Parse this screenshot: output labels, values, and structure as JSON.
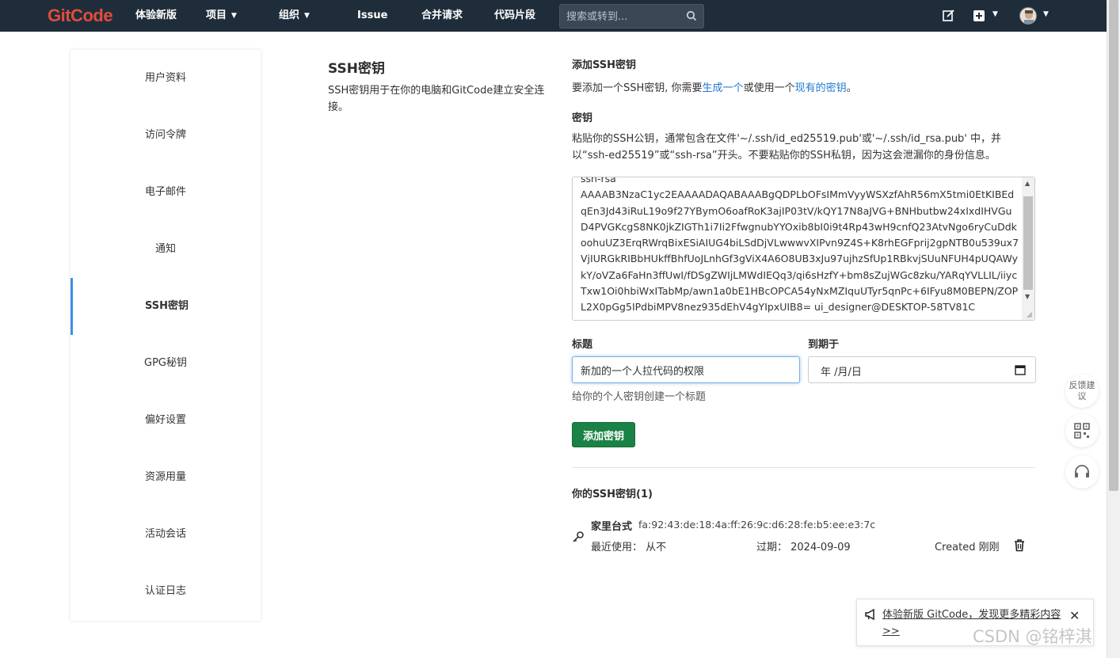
{
  "nav": {
    "logo": "GitCode",
    "items": [
      {
        "label": "体验新版",
        "caret": false
      },
      {
        "label": "项目",
        "caret": true
      },
      {
        "label": "组织",
        "caret": true
      },
      {
        "label": "Issue",
        "caret": false
      },
      {
        "label": "合并请求",
        "caret": false
      },
      {
        "label": "代码片段",
        "caret": false
      }
    ],
    "search_placeholder": "搜索或转到..."
  },
  "sidebar": {
    "items": [
      "用户资料",
      "访问令牌",
      "电子邮件",
      "通知",
      "SSH密钥",
      "GPG秘钥",
      "偏好设置",
      "资源用量",
      "活动会话",
      "认证日志"
    ],
    "active": "SSH密钥"
  },
  "section": {
    "title": "SSH密钥",
    "description": "SSH密钥用于在你的电脑和GitCode建立安全连接。"
  },
  "form": {
    "add_heading": "添加SSH密钥",
    "add_text_pre": "要添加一个SSH密钥, 你需要",
    "add_link_generate": "生成一个",
    "add_text_mid": "或使用一个",
    "add_link_existing": "现有的密钥",
    "add_text_post": "。",
    "key_label": "密钥",
    "key_hint": "粘贴你的SSH公钥，通常包含在文件'~/.ssh/id_ed25519.pub'或'~/.ssh/id_rsa.pub' 中，并以“ssh-ed25519”或“ssh-rsa”开头。不要粘贴你的SSH私钥，因为这会泄漏你的身份信息。",
    "key_value": "ssh-rsa AAAAB3NzaC1yc2EAAAADAQABAAABgQDPLbOFsIMmVyyWSXzfAhR56mX5tmi0EtKIBEdqEn3Jd43iRuL19o9f27YBymO6oafRoK3ajIP03tV/kQY17N8aJVG+BNHbutbw24xIxdIHVGuD4PVGKcgS8NK0jkZIGTh1i7Ii2FfwgnubYYOxib8bI0i9t4Rp43wH9cnfQ23AtvNgo6ryCuDdkoohuUZ3ErqRWrqBixESiAIUG4biLSdDjVLwwwvXIPvn9Z4S+K8rhEGFprij2gpNTB0u539ux7VjIURGkRIBbHUkffBhfUoJLnhGf3gViX4A6O8UB3xJu97ujhzSfUp1RBkvjSUuNFUH4pUQAWykY/oVZa6FaHn3ffUwI/fDSgZWIjLMWdIEQq3/qi6sHzfY+bm8sZujWGc8zku/YARqYVLLIL/iiycTxw1Oi0hbiWxITabMp/awn1a0bE1HBcOPCA54yNxMZIquUTyr5qnPc+6IFyu8M0BEPN/ZOPL2X0pGg5IPdbiMPV8nez935dEhV4gYIpxUIB8= ui_designer@DESKTOP-58TV81C",
    "title_label": "标题",
    "title_value": "新加的一个人拉代码的权限",
    "expires_label": "到期于",
    "expires_value": "年 /月/日",
    "title_hint": "给你的个人密钥创建一个标题",
    "submit_label": "添加密钥"
  },
  "keys": {
    "heading": "你的SSH密钥(1)",
    "items": [
      {
        "name": "家里台式",
        "fingerprint": "fa:92:43:de:18:4a:ff:26:9c:d6:28:fe:b5:ee:e3:7c",
        "last_used": "最近使用： 从不",
        "expires": "过期： 2024-09-09",
        "created": "Created 刚刚"
      }
    ]
  },
  "floating": {
    "feedback": "反馈建议"
  },
  "notice": {
    "text": "体验新版 GitCode，发现更多精彩内容 >>",
    "close": "✕"
  },
  "watermark": "CSDN @铭梓淇",
  "colors": {
    "nav_bg": "#1f2d3a",
    "accent": "#1f78d1",
    "active_bar": "#3d8fe8",
    "button": "#1a8245",
    "logo": "#e44c3c"
  }
}
